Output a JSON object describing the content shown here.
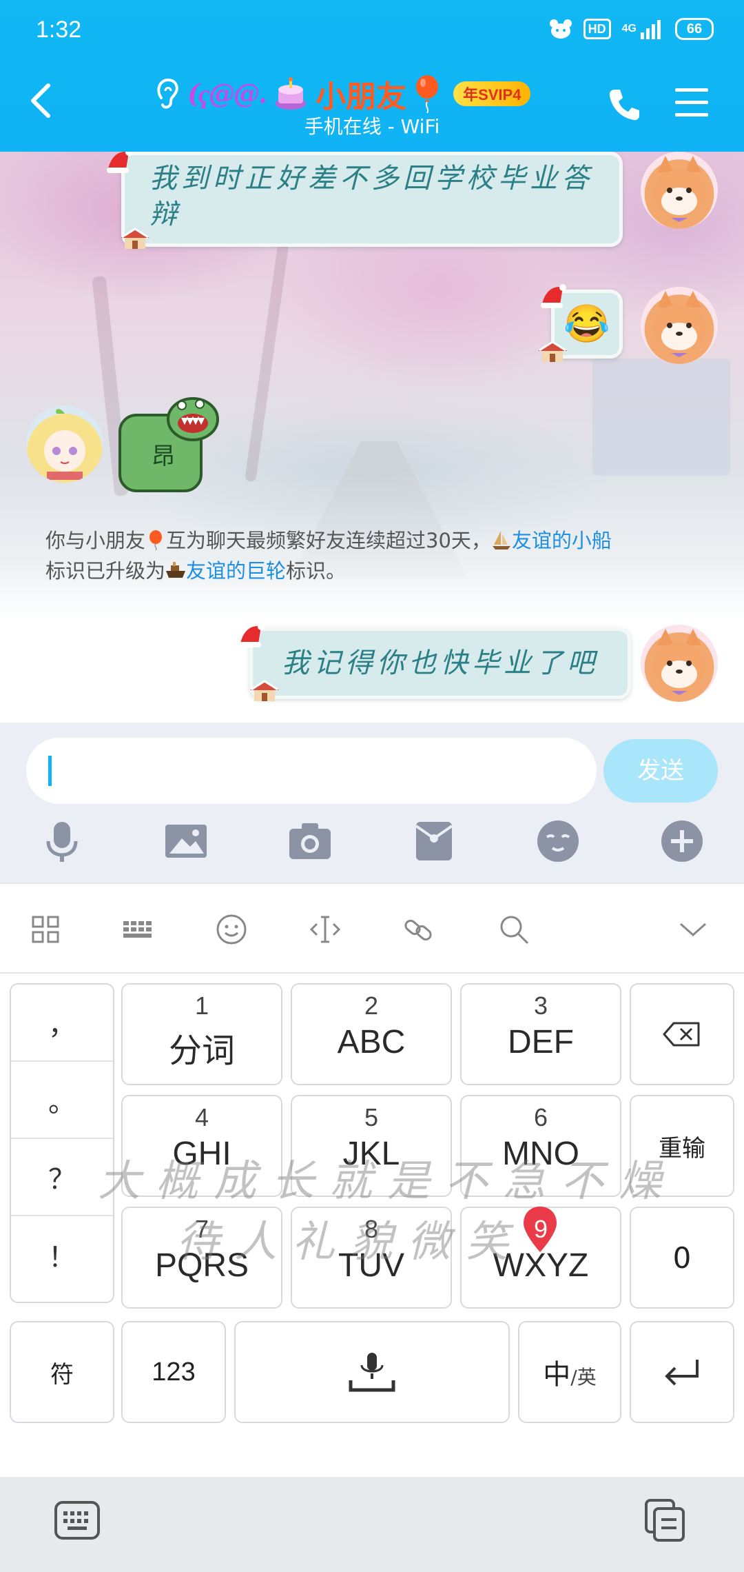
{
  "status_bar": {
    "time": "1:32",
    "hd_label": "HD",
    "network_label": "4G",
    "battery_label": "66"
  },
  "header": {
    "deco_logo": "(ҁ@@.",
    "contact_name": "小朋友",
    "svip_badge": "年SVIP4",
    "subtitle": "手机在线 - WiFi"
  },
  "messages": [
    {
      "side": "right",
      "kind": "text",
      "text": "我到时正好差不多回学校毕业答辩"
    },
    {
      "side": "right",
      "kind": "emoji",
      "text": "😂"
    },
    {
      "side": "left",
      "kind": "sticker",
      "text": "昂"
    },
    {
      "side": "right",
      "kind": "text",
      "text": "我记得你也快毕业了吧"
    }
  ],
  "system_note": {
    "part1": "你与小朋友",
    "part2": "互为聊天最频繁好友连续超过30天，",
    "link1": "友谊的小船",
    "part3": "标识已升级为",
    "link2": "友谊的巨轮",
    "part4": "标识。"
  },
  "input": {
    "placeholder": "",
    "send_label": "发送"
  },
  "tools": [
    "microphone-icon",
    "image-icon",
    "camera-icon",
    "red-packet-icon",
    "emoji-icon",
    "plus-icon"
  ],
  "keyboard": {
    "toolbar": [
      "grid-icon",
      "keyboard-layout-icon",
      "smiley-icon",
      "cursor-icon",
      "link-icon",
      "search-icon",
      "collapse-icon"
    ],
    "punctuation": [
      "，",
      "。",
      "？",
      "！"
    ],
    "keys": [
      {
        "num": "1",
        "label": "分词"
      },
      {
        "num": "2",
        "label": "ABC"
      },
      {
        "num": "3",
        "label": "DEF"
      },
      {
        "num": "4",
        "label": "GHI"
      },
      {
        "num": "5",
        "label": "JKL"
      },
      {
        "num": "6",
        "label": "MNO"
      },
      {
        "num": "7",
        "label": "PQRS"
      },
      {
        "num": "8",
        "label": "TUV"
      },
      {
        "num": "9",
        "label": "WXYZ"
      }
    ],
    "reinput_label": "重输",
    "zero_label": "0",
    "symbol_label": "符",
    "numeric_label": "123",
    "lang_main": "中",
    "lang_sub": "/英",
    "watermark_line1": "大概成长就是不急不燥",
    "watermark_line2": "待人礼貌微笑"
  },
  "colors": {
    "header": "#10b3f5",
    "bubble_text": "#2b7f86",
    "link": "#1e8fe0",
    "send_disabled": "#a9e5fb"
  }
}
